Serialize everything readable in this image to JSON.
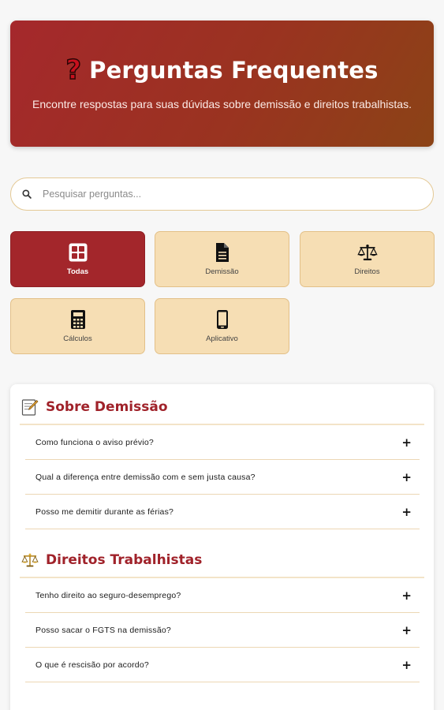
{
  "hero": {
    "icon": "question-mark-icon",
    "title": "Perguntas Frequentes",
    "subtitle": "Encontre respostas para suas dúvidas sobre demissão e direitos trabalhistas."
  },
  "search": {
    "placeholder": "Pesquisar perguntas...",
    "value": ""
  },
  "categories": [
    {
      "label": "Todas",
      "icon": "grid-icon",
      "active": true
    },
    {
      "label": "Demissão",
      "icon": "document-icon",
      "active": false
    },
    {
      "label": "Direitos",
      "icon": "scale-icon",
      "active": false
    },
    {
      "label": "Cálculos",
      "icon": "calculator-icon",
      "active": false
    },
    {
      "label": "Aplicativo",
      "icon": "phone-icon",
      "active": false
    }
  ],
  "sections": [
    {
      "title": "Sobre Demissão",
      "icon": "memo-icon",
      "questions": [
        "Como funciona o aviso prévio?",
        "Qual a diferença entre demissão com e sem justa causa?",
        "Posso me demitir durante as férias?"
      ]
    },
    {
      "title": "Direitos Trabalhistas",
      "icon": "scale-icon",
      "questions": [
        "Tenho direito ao seguro-desemprego?",
        "Posso sacar o FGTS na demissão?",
        "O que é rescisão por acordo?"
      ]
    }
  ],
  "colors": {
    "brand": "#a5282c",
    "category_bg": "#f6deb4",
    "section_title": "#a0222a"
  },
  "expand_symbol": "+"
}
